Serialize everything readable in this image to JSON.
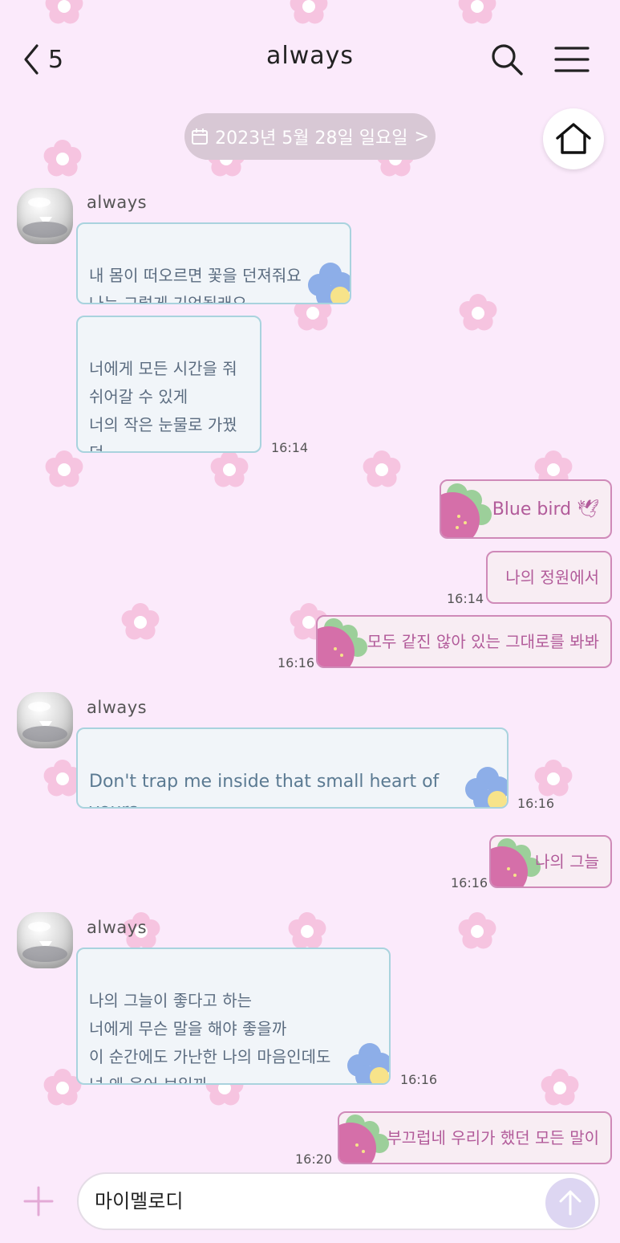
{
  "header": {
    "back_count": "5",
    "title": "always"
  },
  "date_pill": {
    "label": "2023년 5월 28일 일요일",
    "chevron": ">"
  },
  "colors": {
    "background": "#fbeafb",
    "incoming_border": "#a9d3de",
    "outgoing_border": "#cf8ab8",
    "outgoing_text": "#b25b9a",
    "incoming_text": "#5b6c80"
  },
  "messages": [
    {
      "direction": "in",
      "sender": "always",
      "text": "내 몸이 떠오르면 꽃을 던져줘요\n나는 그렇게 기억될래요"
    },
    {
      "direction": "in",
      "text": "너에게 모든 시간을 줘\n쉬어갈 수 있게\n너의 작은 눈물로 가꿨던\n나의 정원에서",
      "time": "16:14"
    },
    {
      "direction": "out",
      "text": "Blue bird 🕊"
    },
    {
      "direction": "out",
      "text": "나의 정원에서",
      "time": "16:14"
    },
    {
      "direction": "out",
      "text": "모두 같진 않아 있는 그대로를 봐봐",
      "time": "16:16"
    },
    {
      "direction": "in",
      "sender": "always",
      "text": "Don't trap me inside that small heart of\nyours",
      "time": "16:16"
    },
    {
      "direction": "out",
      "text": "나의 그늘",
      "time": "16:16"
    },
    {
      "direction": "in",
      "sender": "always",
      "text": "나의 그늘이 좋다고 하는\n너에게 무슨 말을 해야 좋을까\n이 순간에도 가난한 나의 마음인데도\n넌 왜 웃어 보일까",
      "time": "16:16"
    },
    {
      "direction": "out",
      "text": "부끄럽네 우리가 했던 모든 말이",
      "time": "16:20"
    }
  ],
  "input": {
    "value": "마이멜로디"
  },
  "icons": [
    "chevron-left-icon",
    "search-icon",
    "menu-icon",
    "calendar-icon",
    "home-icon",
    "plus-icon",
    "send-arrow-icon"
  ]
}
